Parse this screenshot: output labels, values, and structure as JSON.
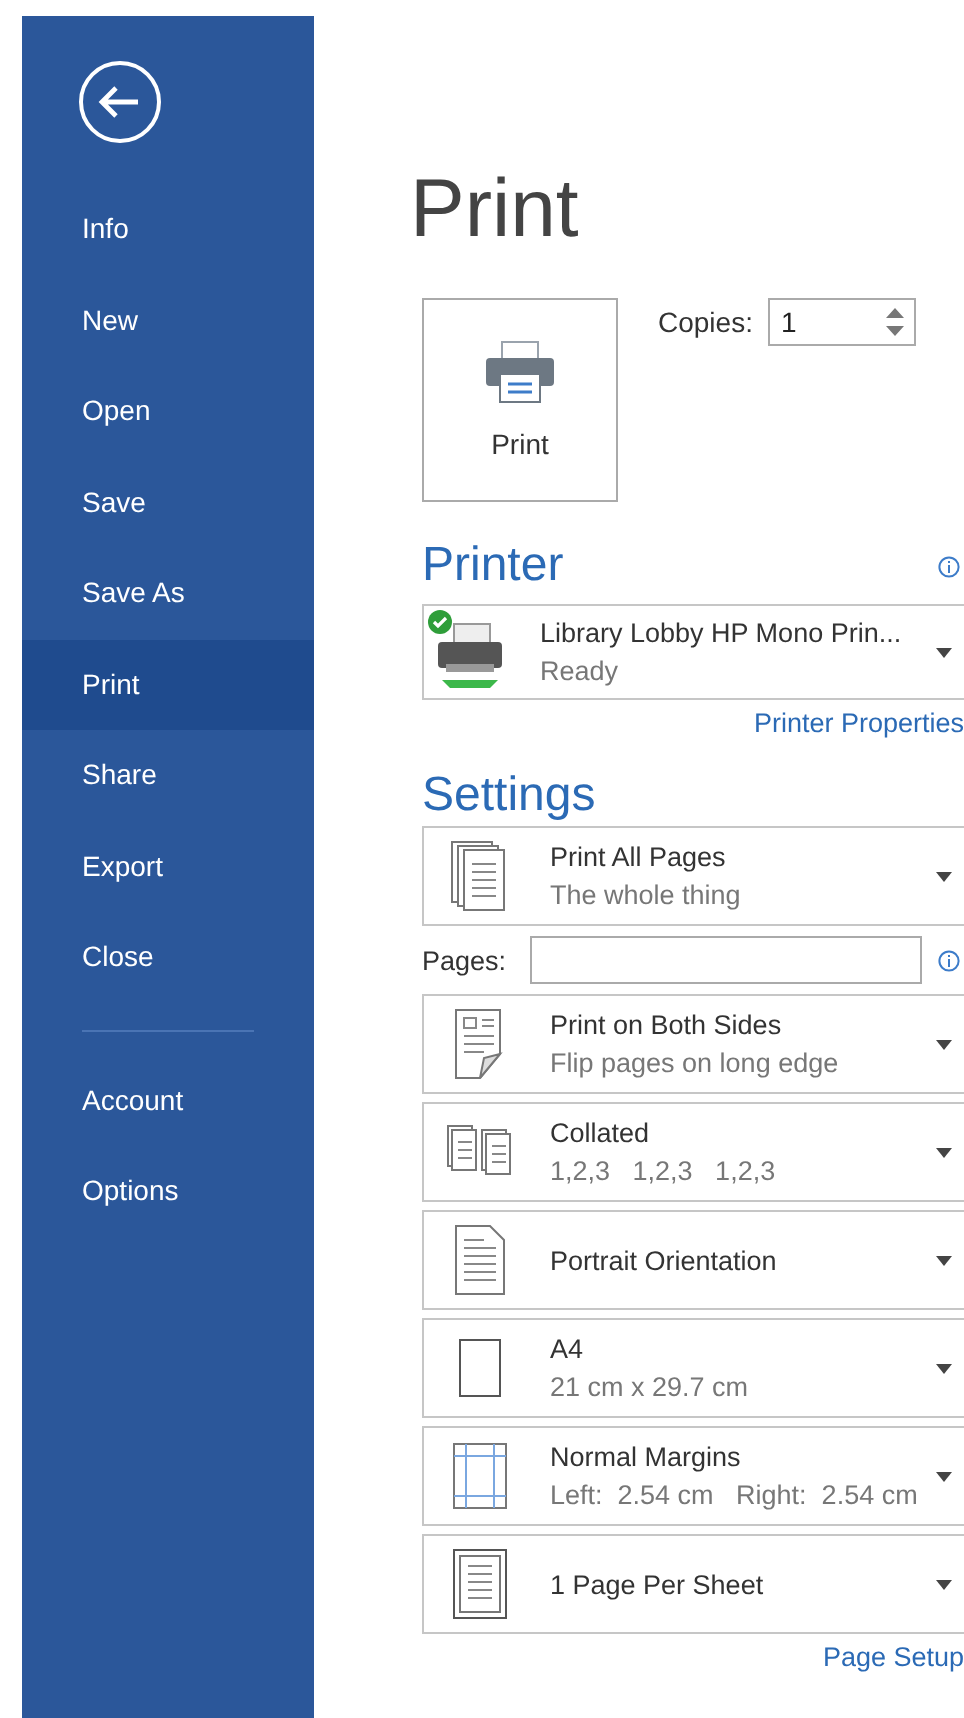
{
  "sidebar": {
    "items": [
      {
        "label": "Info",
        "selected": false
      },
      {
        "label": "New",
        "selected": false
      },
      {
        "label": "Open",
        "selected": false
      },
      {
        "label": "Save",
        "selected": false
      },
      {
        "label": "Save As",
        "selected": false
      },
      {
        "label": "Print",
        "selected": true
      },
      {
        "label": "Share",
        "selected": false
      },
      {
        "label": "Export",
        "selected": false
      },
      {
        "label": "Close",
        "selected": false
      }
    ],
    "bottom_items": [
      {
        "label": "Account",
        "selected": false
      },
      {
        "label": "Options",
        "selected": false
      }
    ]
  },
  "title": "Print",
  "print_button": {
    "label": "Print"
  },
  "copies": {
    "label": "Copies:",
    "value": "1"
  },
  "printer": {
    "heading": "Printer",
    "name": "Library Lobby HP Mono Prin...",
    "status": "Ready",
    "link": "Printer Properties"
  },
  "settings": {
    "heading": "Settings",
    "items": [
      {
        "kind": "pages",
        "title": "Print All Pages",
        "subtitle": "The whole thing"
      },
      {
        "kind": "field",
        "label": "Pages:"
      },
      {
        "kind": "sides",
        "title": "Print on Both Sides",
        "subtitle": "Flip pages on long edge"
      },
      {
        "kind": "collate",
        "title": "Collated",
        "subtitle": "1,2,3   1,2,3   1,2,3"
      },
      {
        "kind": "orientation",
        "title": "Portrait Orientation"
      },
      {
        "kind": "paper",
        "title": "A4",
        "subtitle": "21 cm x 29.7 cm"
      },
      {
        "kind": "margins",
        "title": "Normal Margins",
        "subtitle": "Left:  2.54 cm   Right:  2.54 cm"
      },
      {
        "kind": "persheet",
        "title": "1 Page Per Sheet"
      }
    ],
    "link": "Page Setup"
  }
}
